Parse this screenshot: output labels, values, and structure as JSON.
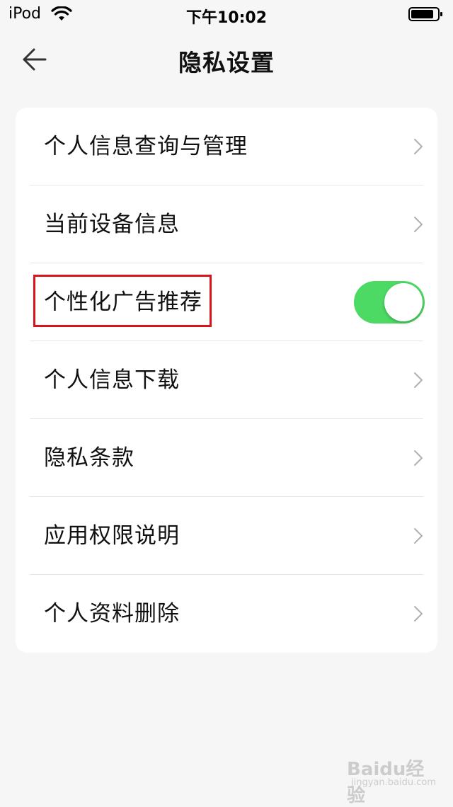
{
  "status_bar": {
    "carrier": "iPod",
    "time": "下午10:02",
    "wifi_icon": "wifi-icon",
    "battery_icon": "battery-icon",
    "battery_level": 0.85
  },
  "nav": {
    "back_icon": "arrow-left-icon",
    "title": "隐私设置"
  },
  "settings": {
    "items": [
      {
        "label": "个人信息查询与管理",
        "control": "chevron"
      },
      {
        "label": "当前设备信息",
        "control": "chevron"
      },
      {
        "label": "个性化广告推荐",
        "control": "toggle",
        "toggle_on": true,
        "highlighted": true
      },
      {
        "label": "个人信息下载",
        "control": "chevron"
      },
      {
        "label": "隐私条款",
        "control": "chevron"
      },
      {
        "label": "应用权限说明",
        "control": "chevron"
      },
      {
        "label": "个人资料删除",
        "control": "chevron"
      }
    ]
  },
  "colors": {
    "toggle_on": "#4cd964",
    "highlight_border": "#d9141b",
    "background": "#f6f6f6",
    "card": "#ffffff"
  },
  "watermark": {
    "text": "Baidu经验",
    "sub": "jingyan.baidu.com"
  }
}
